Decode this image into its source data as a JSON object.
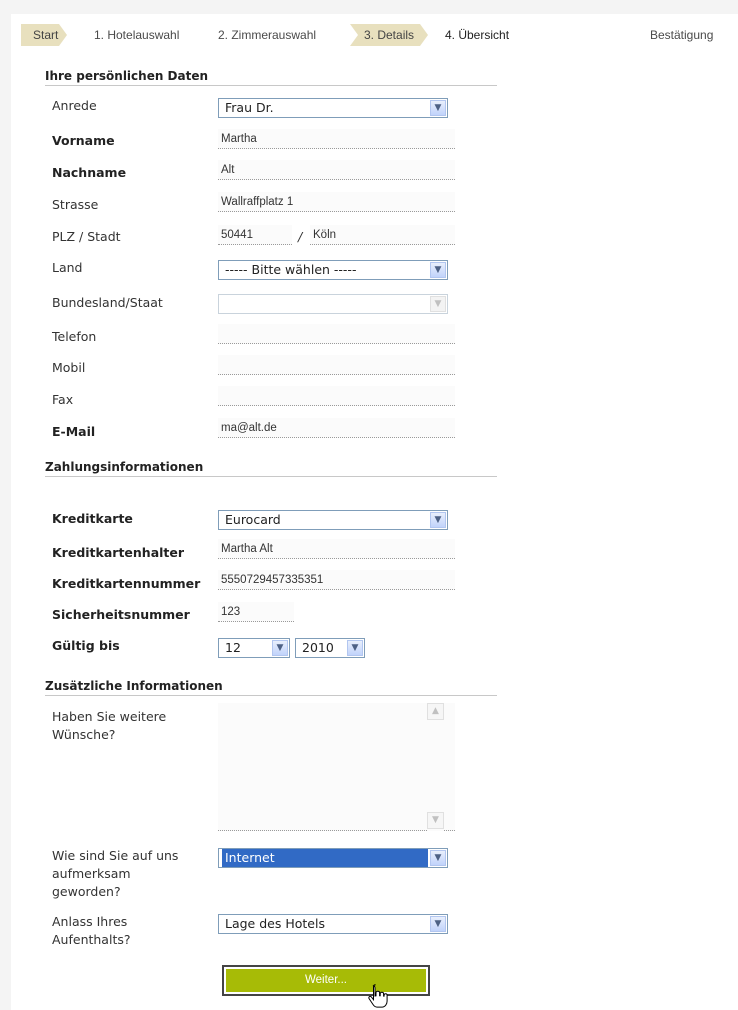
{
  "steps": {
    "start": "Start",
    "hotel": "1. Hotelauswahl",
    "zimmer": "2. Zimmerauswahl",
    "details": "3. Details",
    "uebersicht": "4. Übersicht",
    "bestaetigung": "Bestätigung"
  },
  "personal": {
    "heading": "Ihre persönlichen Daten",
    "anrede_label": "Anrede",
    "anrede_value": "Frau Dr.",
    "vorname_label": "Vorname",
    "vorname_value": "Martha",
    "nachname_label": "Nachname",
    "nachname_value": "Alt",
    "strasse_label": "Strasse",
    "strasse_value": "Wallraffplatz 1",
    "plz_label": "PLZ / Stadt",
    "plz_value": "50441",
    "plz_sep": "/",
    "stadt_value": "Köln",
    "land_label": "Land",
    "land_value": "----- Bitte wählen -----",
    "bundesland_label": "Bundesland/Staat",
    "bundesland_value": "",
    "telefon_label": "Telefon",
    "telefon_value": "",
    "mobil_label": "Mobil",
    "mobil_value": "",
    "fax_label": "Fax",
    "fax_value": "",
    "email_label": "E-Mail",
    "email_value": "ma@alt.de"
  },
  "payment": {
    "heading": "Zahlungsinformationen",
    "karte_label": "Kreditkarte",
    "karte_value": "Eurocard",
    "halter_label": "Kreditkartenhalter",
    "halter_value": "Martha Alt",
    "nummer_label": "Kreditkartennummer",
    "nummer_value": "5550729457335351",
    "sicherheit_label": "Sicherheitsnummer",
    "sicherheit_value": "123",
    "gueltig_label": "Gültig bis",
    "monat_value": "12",
    "jahr_value": "2010"
  },
  "extra": {
    "heading": "Zusätzliche Informationen",
    "wuensche_label_1": "Haben Sie weitere",
    "wuensche_label_2": "Wünsche?",
    "wuensche_value": "",
    "quelle_label_1": "Wie sind Sie auf uns",
    "quelle_label_2": "aufmerksam",
    "quelle_label_3": "geworden?",
    "quelle_value": "Internet",
    "anlass_label_1": "Anlass Ihres",
    "anlass_label_2": "Aufenthalts?",
    "anlass_value": "Lage des Hotels"
  },
  "submit_label": "Weiter...",
  "colors": {
    "step_done_bg": "#e8e0be",
    "button_green": "#a7bb06",
    "select_border": "#7f9db9",
    "highlight": "#316ac5"
  }
}
